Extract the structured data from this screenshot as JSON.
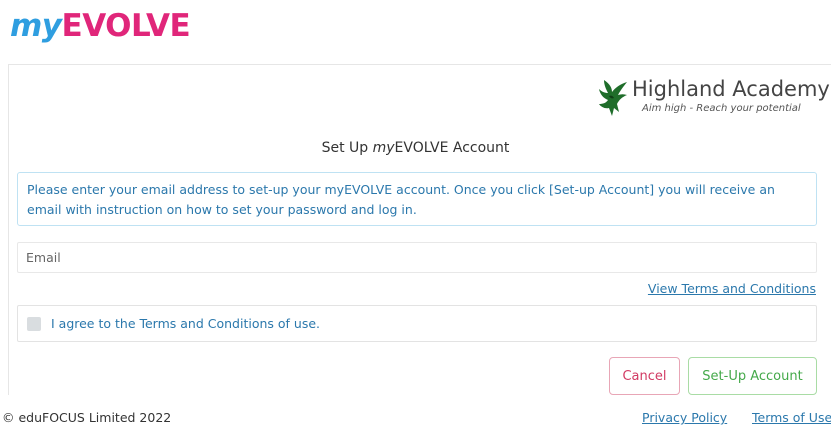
{
  "brand": {
    "prefix": "my",
    "name": "EVOLVE"
  },
  "school": {
    "name": "Highland Academy",
    "tagline": "Aim high - Reach your potential"
  },
  "form": {
    "title_plain_1": "Set Up ",
    "title_em": "my",
    "title_plain_2": "EVOLVE Account",
    "info": "Please enter your email address to set-up your myEVOLVE account. Once you click [Set-up Account] you will receive an email with instruction on how to set your password and log in.",
    "email_placeholder": "Email",
    "email_value": "",
    "terms_link": "View Terms and Conditions",
    "agree_label": "I agree to the Terms and Conditions of use.",
    "agree_checked": false,
    "cancel_label": "Cancel",
    "setup_label": "Set-Up Account"
  },
  "footer": {
    "copyright": "© eduFOCUS Limited 2022",
    "privacy": "Privacy Policy",
    "terms": "Terms of Use"
  },
  "colors": {
    "brand_blue": "#2f9ee0",
    "brand_pink": "#e0267a",
    "link": "#2b78ac",
    "cancel": "#d23a63",
    "setup": "#44a94a",
    "eagle": "#1f6d2a"
  },
  "icons": {
    "school_logo": "eagle-logo-icon",
    "checkbox": "checkbox-icon"
  }
}
